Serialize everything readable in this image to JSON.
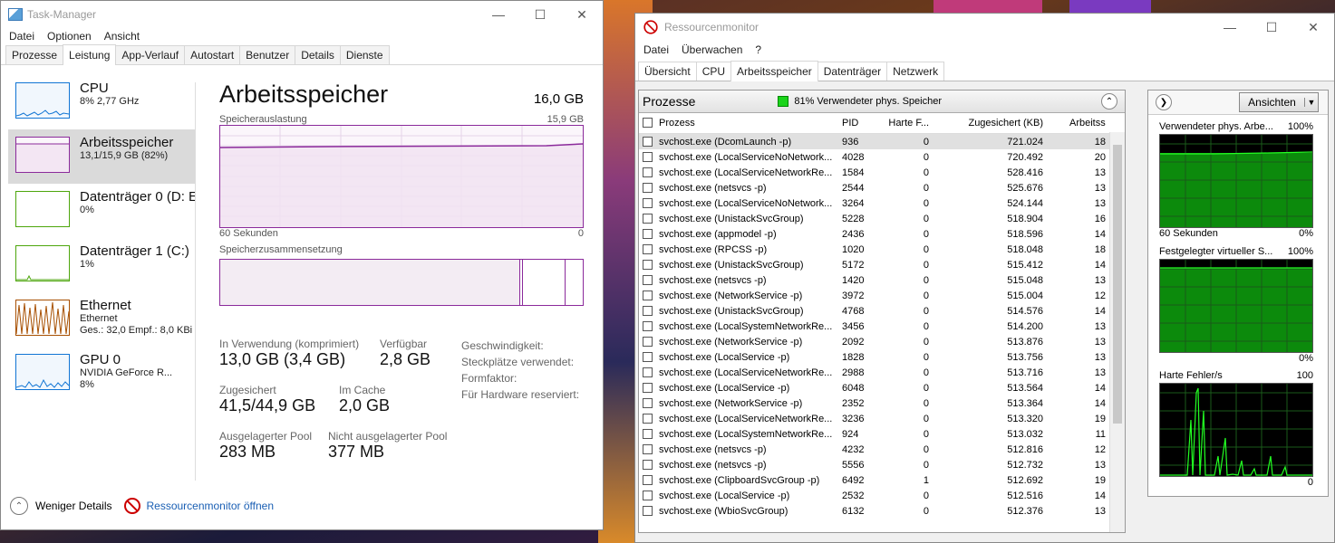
{
  "taskmanager": {
    "title": "Task-Manager",
    "menu": [
      "Datei",
      "Optionen",
      "Ansicht"
    ],
    "tabs": [
      "Prozesse",
      "Leistung",
      "App-Verlauf",
      "Autostart",
      "Benutzer",
      "Details",
      "Dienste"
    ],
    "active_tab": "Leistung",
    "resources": [
      {
        "name": "CPU",
        "line1": "8% 2,77 GHz",
        "line2": "",
        "line3": "",
        "color": "#1175d4"
      },
      {
        "name": "Arbeitsspeicher",
        "line1": "13,1/15,9 GB (82%)",
        "line2": "",
        "line3": "",
        "color": "#8b2a9b"
      },
      {
        "name": "Datenträger 0 (D: E",
        "line1": "0%",
        "line2": "",
        "line3": "",
        "color": "#4da60c"
      },
      {
        "name": "Datenträger 1 (C:)",
        "line1": "1%",
        "line2": "",
        "line3": "",
        "color": "#4da60c"
      },
      {
        "name": "Ethernet",
        "line1": "Ethernet",
        "line2": "Ges.: 32,0  Empf.: 8,0 KBi",
        "line3": "",
        "color": "#a74f01"
      },
      {
        "name": "GPU 0",
        "line1": "NVIDIA GeForce R...",
        "line2": "8%",
        "line3": "",
        "color": "#1175d4"
      }
    ],
    "detail": {
      "title": "Arbeitsspeicher",
      "total": "16,0 GB",
      "usage_label": "Speicherauslastung",
      "usage_max": "15,9 GB",
      "axis_left": "60 Sekunden",
      "axis_right": "0",
      "composition_label": "Speicherzusammensetzung",
      "in_use_label": "In Verwendung (komprimiert)",
      "in_use_value": "13,0 GB (3,4 GB)",
      "available_label": "Verfügbar",
      "available_value": "2,8 GB",
      "committed_label": "Zugesichert",
      "committed_value": "41,5/44,9 GB",
      "cached_label": "Im Cache",
      "cached_value": "2,0 GB",
      "paged_label": "Ausgelagerter Pool",
      "paged_value": "283 MB",
      "nonpaged_label": "Nicht ausgelagerter Pool",
      "nonpaged_value": "377 MB",
      "speed_label": "Geschwindigkeit:",
      "slots_label": "Steckplätze verwendet:",
      "form_label": "Formfaktor:",
      "reserved_label": "Für Hardware reserviert:"
    },
    "footer": {
      "less_details": "Weniger Details",
      "open_monitor": "Ressourcenmonitor öffnen"
    }
  },
  "resmon": {
    "title": "Ressourcenmonitor",
    "menu": [
      "Datei",
      "Überwachen",
      "?"
    ],
    "tabs": [
      "Übersicht",
      "CPU",
      "Arbeitsspeicher",
      "Datenträger",
      "Netzwerk"
    ],
    "active_tab": "Arbeitsspeicher",
    "section_title": "Prozesse",
    "status": "81% Verwendeter phys. Speicher",
    "columns": [
      "Prozess",
      "PID",
      "Harte F...",
      "Zugesichert (KB)",
      "Arbeitssa"
    ],
    "rows": [
      [
        "svchost.exe (DcomLaunch -p)",
        "936",
        "0",
        "721.024",
        "18"
      ],
      [
        "svchost.exe (LocalServiceNoNetwork...",
        "4028",
        "0",
        "720.492",
        "20"
      ],
      [
        "svchost.exe (LocalServiceNetworkRe...",
        "1584",
        "0",
        "528.416",
        "13"
      ],
      [
        "svchost.exe (netsvcs -p)",
        "2544",
        "0",
        "525.676",
        "13"
      ],
      [
        "svchost.exe (LocalServiceNoNetwork...",
        "3264",
        "0",
        "524.144",
        "13"
      ],
      [
        "svchost.exe (UnistackSvcGroup)",
        "5228",
        "0",
        "518.904",
        "16"
      ],
      [
        "svchost.exe (appmodel -p)",
        "2436",
        "0",
        "518.596",
        "14"
      ],
      [
        "svchost.exe (RPCSS -p)",
        "1020",
        "0",
        "518.048",
        "18"
      ],
      [
        "svchost.exe (UnistackSvcGroup)",
        "5172",
        "0",
        "515.412",
        "14"
      ],
      [
        "svchost.exe (netsvcs -p)",
        "1420",
        "0",
        "515.048",
        "13"
      ],
      [
        "svchost.exe (NetworkService -p)",
        "3972",
        "0",
        "515.004",
        "12"
      ],
      [
        "svchost.exe (UnistackSvcGroup)",
        "4768",
        "0",
        "514.576",
        "14"
      ],
      [
        "svchost.exe (LocalSystemNetworkRe...",
        "3456",
        "0",
        "514.200",
        "13"
      ],
      [
        "svchost.exe (NetworkService -p)",
        "2092",
        "0",
        "513.876",
        "13"
      ],
      [
        "svchost.exe (LocalService -p)",
        "1828",
        "0",
        "513.756",
        "13"
      ],
      [
        "svchost.exe (LocalServiceNetworkRe...",
        "2988",
        "0",
        "513.716",
        "13"
      ],
      [
        "svchost.exe (LocalService -p)",
        "6048",
        "0",
        "513.564",
        "14"
      ],
      [
        "svchost.exe (NetworkService -p)",
        "2352",
        "0",
        "513.364",
        "14"
      ],
      [
        "svchost.exe (LocalServiceNetworkRe...",
        "3236",
        "0",
        "513.320",
        "19"
      ],
      [
        "svchost.exe (LocalSystemNetworkRe...",
        "924",
        "0",
        "513.032",
        "11"
      ],
      [
        "svchost.exe (netsvcs -p)",
        "4232",
        "0",
        "512.816",
        "12"
      ],
      [
        "svchost.exe (netsvcs -p)",
        "5556",
        "0",
        "512.732",
        "13"
      ],
      [
        "svchost.exe (ClipboardSvcGroup -p)",
        "6492",
        "1",
        "512.692",
        "19"
      ],
      [
        "svchost.exe (LocalService -p)",
        "2532",
        "0",
        "512.516",
        "14"
      ],
      [
        "svchost.exe (WbioSvcGroup)",
        "6132",
        "0",
        "512.376",
        "13"
      ]
    ],
    "view_button": "Ansichten",
    "graphs": [
      {
        "title": "Verwendeter phys. Arbe...",
        "max": "100%",
        "left_foot": "60 Sekunden",
        "right_foot": "0%"
      },
      {
        "title": "Festgelegter virtueller S...",
        "max": "100%",
        "left_foot": "",
        "right_foot": "0%"
      },
      {
        "title": "Harte Fehler/s",
        "max": "100",
        "left_foot": "",
        "right_foot": "0"
      }
    ]
  }
}
